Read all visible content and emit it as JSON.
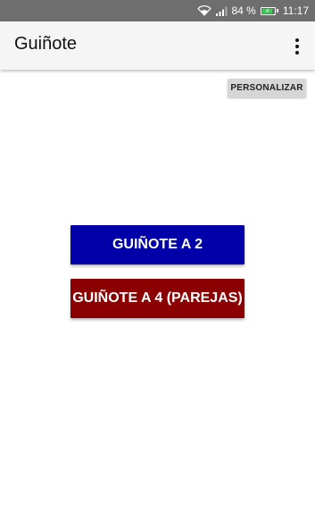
{
  "status_bar": {
    "battery_percent": "84 %",
    "time": "11:17",
    "battery_level": 0.84,
    "icons": [
      "wifi-icon",
      "signal-icon",
      "battery-charging-icon"
    ],
    "background": "#6e6e6e"
  },
  "app_bar": {
    "title": "Guiñote",
    "menu_icon": "overflow-menu-icon",
    "background": "#f5f5f5"
  },
  "main": {
    "personalizar_label": "PERSONALIZAR",
    "buttons": [
      {
        "label": "GUIÑOTE A 2",
        "color": "#0000a8"
      },
      {
        "label": "GUIÑOTE A 4 (PAREJAS)",
        "color": "#8b0000"
      }
    ]
  }
}
